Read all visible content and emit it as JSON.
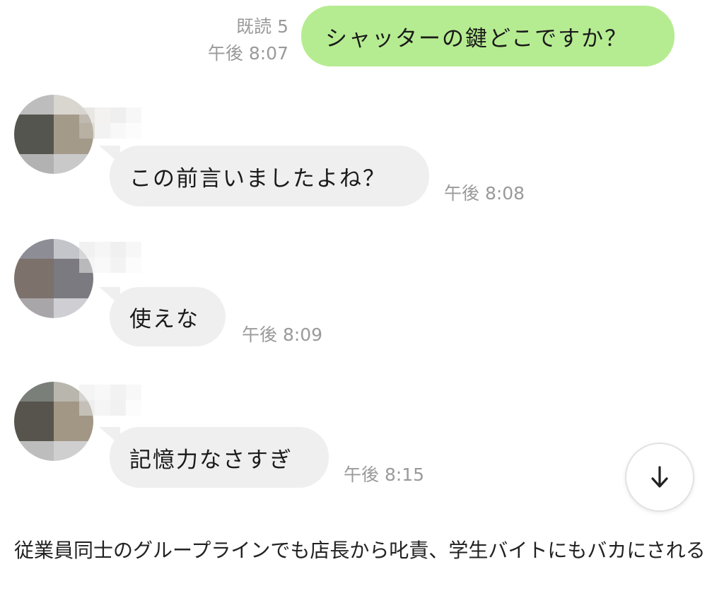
{
  "messages": {
    "m1": {
      "text": "シャッターの鍵どこですか？",
      "read": "既読 5",
      "time": "午後 8:07"
    },
    "m2": {
      "text": "この前言いましたよね？",
      "time": "午後 8:08"
    },
    "m3": {
      "text": "使えな",
      "time": "午後 8:09"
    },
    "m4": {
      "text": "記憶力なさすぎ",
      "time": "午後 8:15"
    }
  },
  "scroll_button": {
    "icon": "arrow-down-icon"
  },
  "caption": "従業員同士のグループラインでも店長から叱責、学生バイトにもバカにされる",
  "colors": {
    "outgoing_bubble": "#b6ec91",
    "incoming_bubble": "#efefef",
    "meta_text": "#9a9a9a"
  }
}
